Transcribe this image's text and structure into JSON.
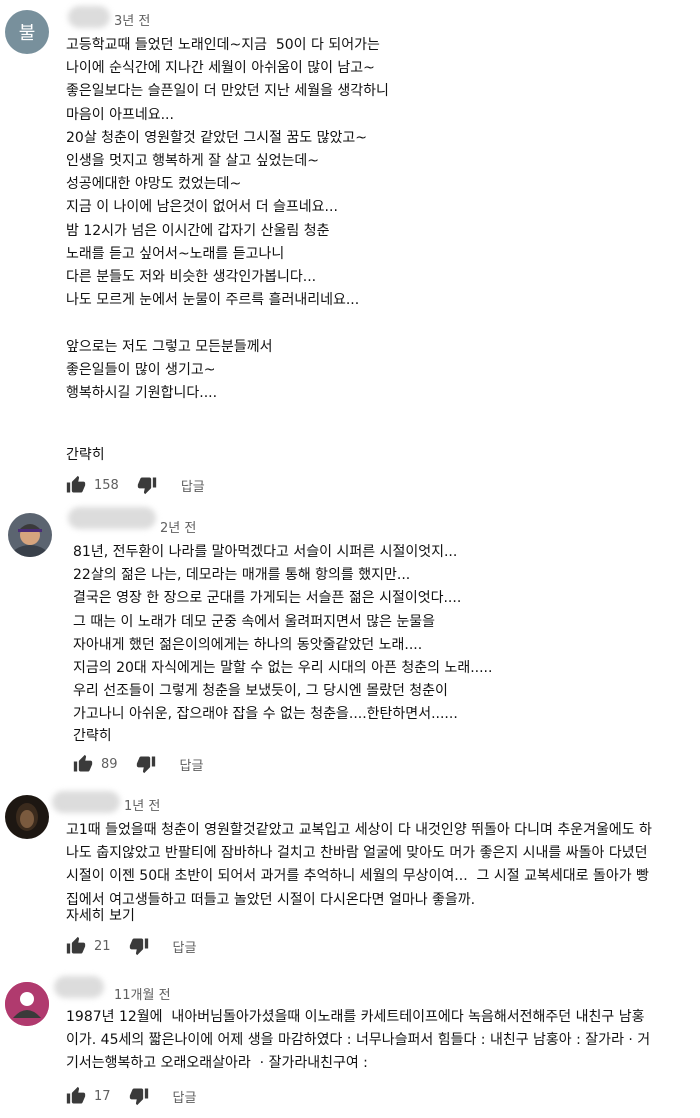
{
  "comments": [
    {
      "avatar_letter": "불",
      "time": "3년 전",
      "text": "고등학교때 들었던 노래인데~지금  50이 다 되어가는\n나이에 순식간에 지나간 세월이 아쉬움이 많이 남고~\n좋은일보다는 슬픈일이 더 만았던 지난 세월을 생각하니\n마음이 아프네요...\n20살 청춘이 영원할것 같았던 그시절 꿈도 많았고~\n인생을 멋지고 행복하게 잘 살고 싶었는데~\n성공에대한 야망도 컸었는데~\n지금 이 나이에 남은것이 없어서 더 슬프네요...\n밤 12시가 넘은 이시간에 갑자기 산울림 청춘\n노래를 듣고 싶어서~노래를 듣고나니\n다른 분들도 저와 비슷한 생각인가봅니다...\n나도 모르게 눈에서 눈물이 주르륵 흘러내리네요...\n\n앞으로는 저도 그렇고 모든분들께서\n좋은일들이 많이 생기고~\n행복하시길 기원합니다....",
      "more": "간략히",
      "likes": "158",
      "reply": "답글"
    },
    {
      "time": "2년 전",
      "text": "81년, 전두환이 나라를 말아먹겠다고 서슬이 시퍼른 시절이엇지...\n22살의 젊은 나는, 데모라는 매개를 통해 항의를 했지만...\n결국은 영장 한 장으로 군대를 가게되는 서슬픈 젊은 시절이엇다....\n그 때는 이 노래가 데모 군중 속에서 울려퍼지면서 많은 눈물을\n자아내게 했던 젊은이의에게는 하나의 동앗줄같았던 노래....\n지금의 20대 자식에게는 말할 수 없는 우리 시대의 아픈 청춘의 노래.....\n우리 선조들이 그렇게 청춘을 보냈듯이, 그 당시엔 몰랐던 청춘이\n가고나니 아쉬운, 잡으래야 잡을 수 없는 청춘을....한탄하면서......",
      "more": "간략히",
      "likes": "89",
      "reply": "답글"
    },
    {
      "time": "1년 전",
      "text": "고1때 들었을때 청춘이 영원할것같았고 교복입고 세상이 다 내것인양 뛰돌아 다니며 추운겨울에도 하\n나도 춥지않았고 반팔티에 잠바하나 걸치고 찬바람 얼굴에 맞아도 머가 좋은지 시내를 싸돌아 다녔던\n시절이 이젠 50대 초반이 되어서 과거를 추억하니 세월의 무상이여...  그 시절 교복세대로 돌아가 빵\n집에서 여고생들하고 떠들고 놀았던 시절이 다시온다면 얼마나 좋을까.",
      "more": "자세히 보기",
      "likes": "21",
      "reply": "답글"
    },
    {
      "time": "11개월 전",
      "text": "1987년 12월에  내아버님돌아가셨을때 이노래를 카세트테이프에다 녹음해서전해주던 내친구 남홍\n이가. 45세의 짧은나이에 어제 생을 마감하였다 : 너무나슬퍼서 힘들다 : 내친구 남홍아 : 잘가라 · 거\n기서는행복하고 오래오래살아라  · 잘가라내친구여 :",
      "likes": "17",
      "reply": "답글"
    }
  ]
}
